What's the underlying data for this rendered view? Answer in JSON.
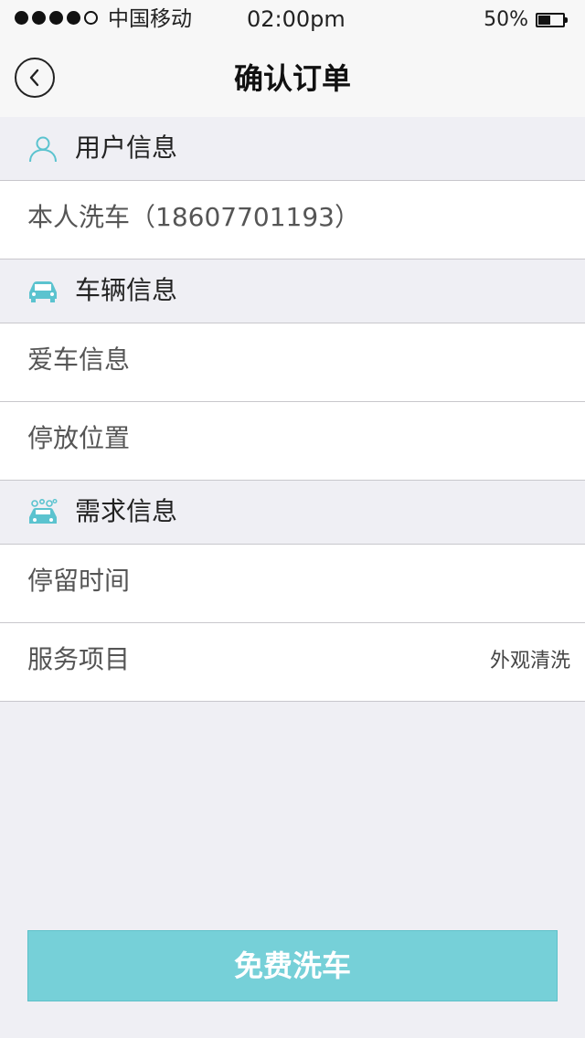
{
  "status_bar": {
    "signal_filled": 4,
    "signal_total": 5,
    "carrier": "中国移动",
    "time": "02:00pm",
    "battery_text": "50%",
    "battery_level": 0.5
  },
  "nav": {
    "back_icon": "chevron-left-icon",
    "title": "确认订单"
  },
  "sections": {
    "user": {
      "icon": "user-icon",
      "title": "用户信息",
      "rows": [
        {
          "label": "本人洗车（18607701193）",
          "value": ""
        }
      ]
    },
    "vehicle": {
      "icon": "car-icon",
      "title": "车辆信息",
      "rows": [
        {
          "label": "爱车信息",
          "value": ""
        },
        {
          "label": "停放位置",
          "value": ""
        }
      ]
    },
    "requirement": {
      "icon": "car-wash-icon",
      "title": "需求信息",
      "rows": [
        {
          "label": "停留时间",
          "value": ""
        },
        {
          "label": "服务项目",
          "value": "外观清洗"
        }
      ]
    }
  },
  "action": {
    "label": "免费洗车"
  },
  "colors": {
    "accent": "#76d0d8",
    "icon": "#5bc3cf",
    "background": "#efeff4",
    "separator": "#c8c7cc"
  }
}
